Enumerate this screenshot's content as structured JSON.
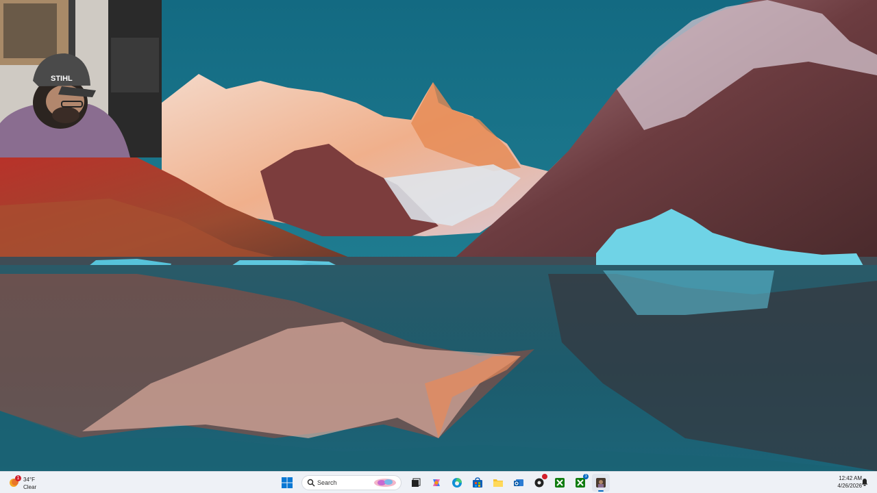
{
  "taskbar": {
    "weather": {
      "temp": "34°F",
      "condition": "Clear",
      "badge": "1"
    },
    "search": {
      "placeholder": "Search"
    },
    "apps": [
      {
        "name": "start-button"
      },
      {
        "name": "search-box"
      },
      {
        "name": "task-view"
      },
      {
        "name": "copilot"
      },
      {
        "name": "edge"
      },
      {
        "name": "microsoft-store"
      },
      {
        "name": "file-explorer"
      },
      {
        "name": "outlook"
      },
      {
        "name": "app-red-badge"
      },
      {
        "name": "xbox"
      },
      {
        "name": "xbox-badge",
        "badge": "3"
      },
      {
        "name": "open-app"
      }
    ],
    "clock": {
      "time": "12:42 AM",
      "date": "4/26/2026"
    }
  },
  "colors": {
    "sky": "#1a6e84",
    "water": "#1a6070",
    "ice": "#6fd3e6",
    "accent": "#0067c0"
  }
}
